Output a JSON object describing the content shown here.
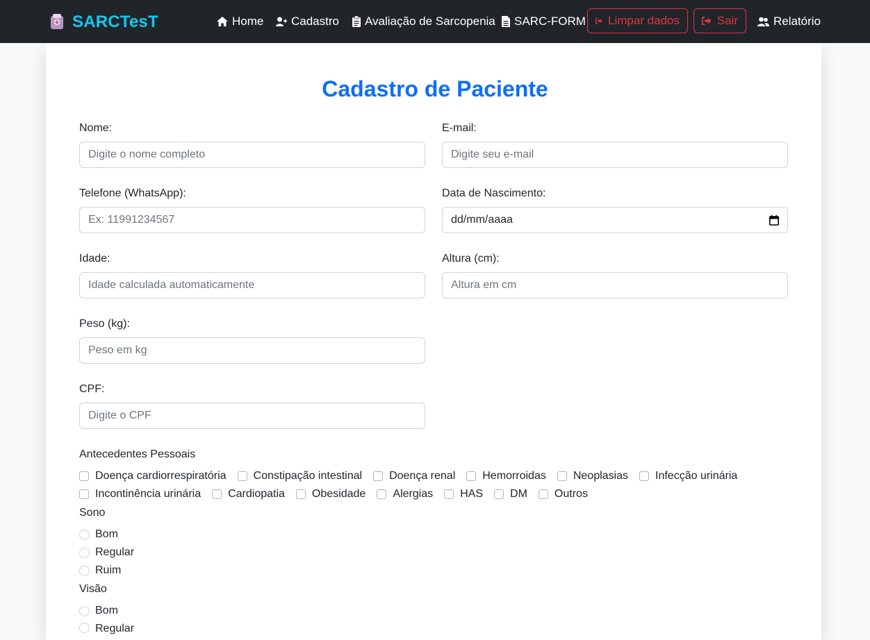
{
  "navbar": {
    "brand": "SARCTesT",
    "links": [
      {
        "label": "Home",
        "icon": "home-icon"
      },
      {
        "label": "Cadastro",
        "icon": "user-plus-icon"
      },
      {
        "label": "Avaliação de Sarcopenia",
        "icon": "clipboard-icon"
      },
      {
        "label": "SARC-FORM",
        "icon": "file-icon"
      }
    ],
    "buttons": [
      {
        "label": "Limpar dados",
        "icon": "sign-out-icon"
      },
      {
        "label": "Sair",
        "icon": "sign-out-icon"
      }
    ],
    "report": {
      "label": "Relatório",
      "icon": "users-icon"
    }
  },
  "form": {
    "title": "Cadastro de Paciente",
    "fields": {
      "nome": {
        "label": "Nome:",
        "placeholder": "Digite o nome completo"
      },
      "email": {
        "label": "E-mail:",
        "placeholder": "Digite seu e-mail"
      },
      "telefone": {
        "label": "Telefone (WhatsApp):",
        "placeholder": "Ex: 11991234567"
      },
      "nascimento": {
        "label": "Data de Nascimento:",
        "value": "dd/mm/aaaa"
      },
      "idade": {
        "label": "Idade:",
        "placeholder": "Idade calculada automaticamente"
      },
      "altura": {
        "label": "Altura (cm):",
        "placeholder": "Altura em cm"
      },
      "peso": {
        "label": "Peso (kg):",
        "placeholder": "Peso em kg"
      },
      "cpf": {
        "label": "CPF:",
        "placeholder": "Digite o CPF"
      }
    },
    "antecedentes": {
      "label": "Antecedentes Pessoais",
      "row1": [
        "Doença cardiorrespiratória",
        "Constipação intestinal",
        "Doença renal",
        "Hemorroidas",
        "Neoplasias",
        "Infecção urinária"
      ],
      "row2": [
        "Incontinência urinária",
        "Cardiopatia",
        "Obesidade",
        "Alergias",
        "HAS",
        "DM",
        "Outros"
      ]
    },
    "sono": {
      "label": "Sono",
      "options": [
        "Bom",
        "Regular",
        "Ruim"
      ]
    },
    "visao": {
      "label": "Visão",
      "options": [
        "Bom",
        "Regular"
      ]
    }
  },
  "colors": {
    "navbar_bg": "#212529",
    "brand": "#0dcaf0",
    "title": "#0d6efd",
    "danger": "#dc3545"
  }
}
